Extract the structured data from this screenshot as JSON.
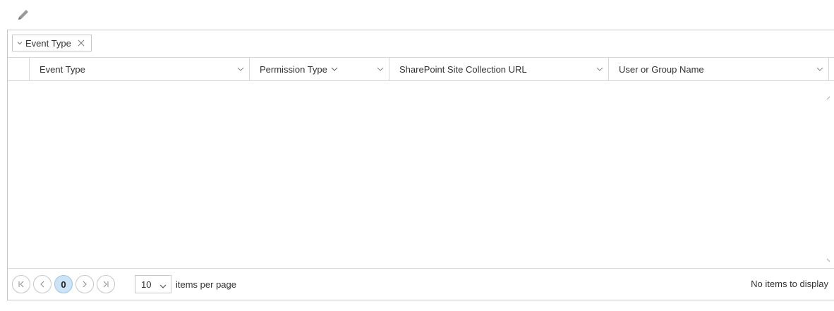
{
  "toolbar": {
    "edit_icon": "pencil-icon"
  },
  "group_bar": {
    "chip_label": "Event Type"
  },
  "columns": [
    {
      "label": "Event Type"
    },
    {
      "label": "Permission Type"
    },
    {
      "label": "SharePoint Site Collection URL"
    },
    {
      "label": "User or Group Name"
    }
  ],
  "pager": {
    "current_page": "0",
    "page_size": "10",
    "items_per_page_label": "items per page",
    "status": "No items to display"
  },
  "colors": {
    "border": "#c8c8c8",
    "current_page_bg": "#cde4f7"
  }
}
